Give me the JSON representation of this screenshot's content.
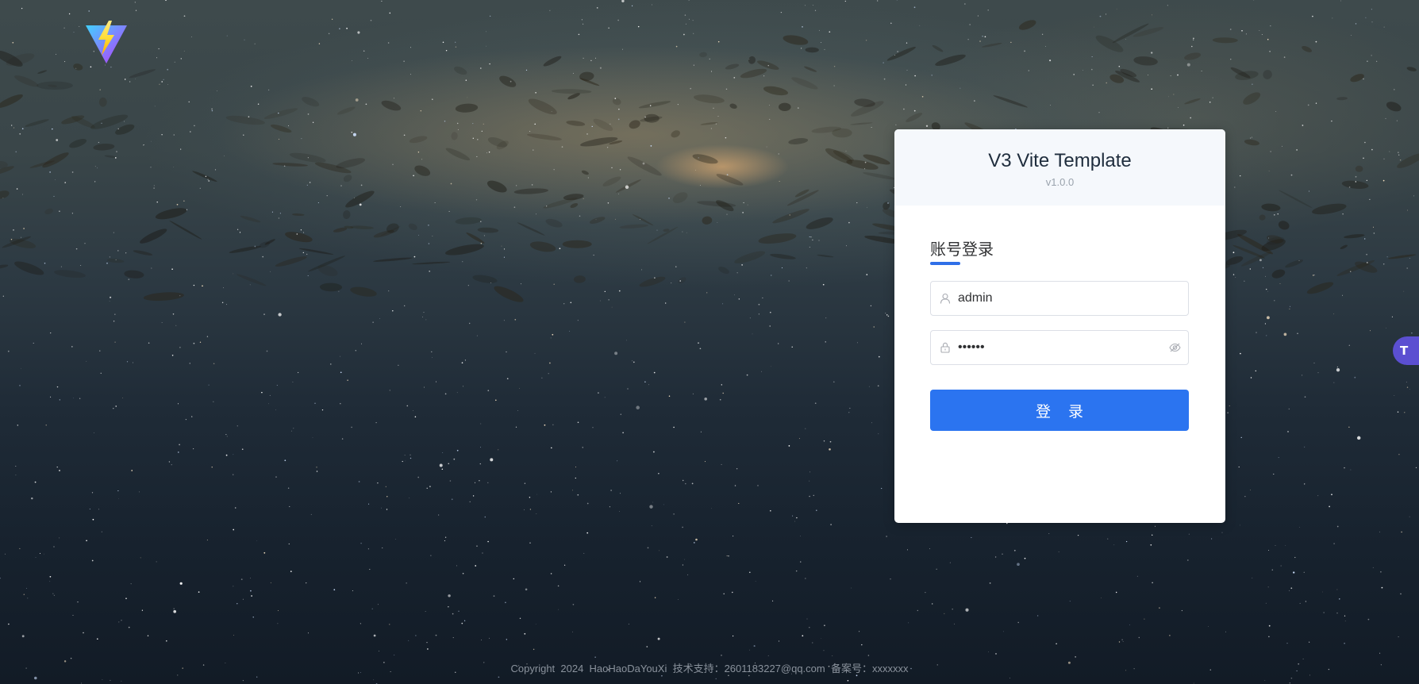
{
  "app": {
    "title": "V3 Vite Template",
    "version": "v1.0.0"
  },
  "login": {
    "tab_label": "账号登录",
    "username_value": "admin",
    "password_value": "••••••",
    "submit_label": "登 录"
  },
  "footer": {
    "text": "Copyright  2024  HaoHaoDaYouXi  技术支持：2601183227@qq.com  备案号：xxxxxxx"
  },
  "side_badge": {
    "letter": "T"
  },
  "colors": {
    "accent": "#2b74f0",
    "card_header_bg": "#f5f8fc",
    "badge": "#5b4fd1"
  },
  "icons": {
    "logo": "vite-logo-icon",
    "username_prefix": "user-icon",
    "password_prefix": "lock-icon",
    "password_suffix": "eye-icon"
  }
}
